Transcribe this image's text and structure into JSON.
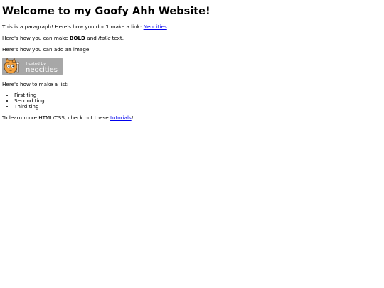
{
  "page": {
    "title": "Welcome to my Goofy Ahh Website!",
    "p1_text": "This is a paragraph! Here's how you don't make a link: ",
    "p1_link": "Neocities",
    "p1_end": ".",
    "p2_pre": "Here's how you can make ",
    "p2_bold": "BOLD",
    "p2_mid": " and ",
    "p2_italic": "italic",
    "p2_end": " text.",
    "p3_text": "Here's how you can add an image:",
    "badge": {
      "line1": "hosted by",
      "line2": "neocities",
      "icon": "neocities-cat-icon"
    },
    "p4_text": "Here's how to make a list:",
    "list": [
      "First ting",
      "Second ting",
      "Third ting"
    ],
    "p5_pre": "To learn more HTML/CSS, check out these ",
    "p5_link": "tutorials",
    "p5_end": "!"
  },
  "colors": {
    "link": "#0000ee",
    "badge_bg": "#a7a7a7",
    "badge_text": "#ffffff"
  }
}
